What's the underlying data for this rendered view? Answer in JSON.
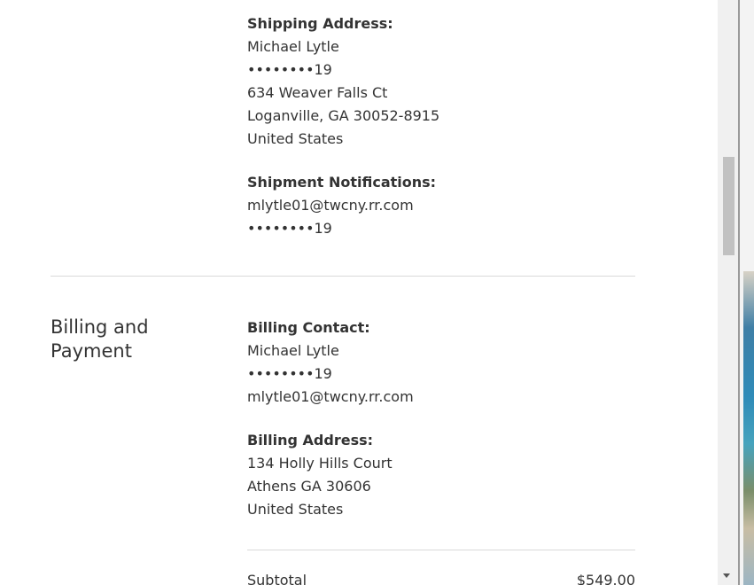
{
  "shipping_address": {
    "heading": "Shipping Address:",
    "name": "Michael Lytle",
    "phone": "••••••••19",
    "street": "634 Weaver Falls Ct",
    "city_state_zip": "Loganville, GA 30052-8915",
    "country": "United States"
  },
  "shipment_notifications": {
    "heading": "Shipment Notifications:",
    "email": "mlytle01@twcny.rr.com",
    "phone": "••••••••19"
  },
  "billing_section": {
    "title": "Billing and Payment",
    "billing_contact": {
      "heading": "Billing Contact:",
      "name": "Michael Lytle",
      "phone": "••••••••19",
      "email": "mlytle01@twcny.rr.com"
    },
    "billing_address": {
      "heading": "Billing Address:",
      "street": "134 Holly Hills Court",
      "city_state_zip": "Athens GA 30606",
      "country": "United States"
    }
  },
  "summary": {
    "subtotal_label": "Subtotal",
    "subtotal_value": "$549.00"
  }
}
